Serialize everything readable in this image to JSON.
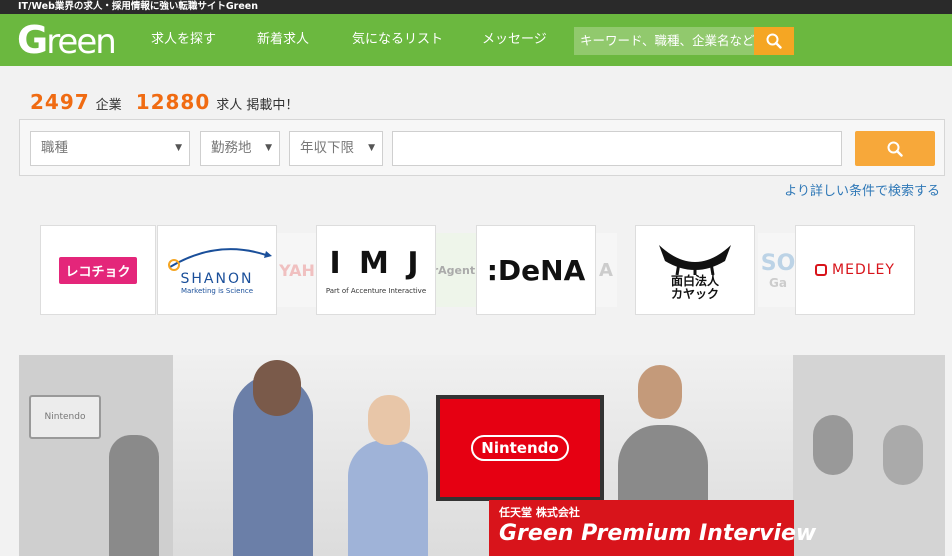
{
  "topbar": {
    "text": "IT/Web業界の求人・採用情報に強い転職サイトGreen"
  },
  "nav": {
    "brand": "reen",
    "brand_initial": "G",
    "links": [
      "求人を探す",
      "新着求人",
      "気になるリスト",
      "メッセージ"
    ],
    "search_placeholder": "キーワード、職種、企業名など"
  },
  "counts": {
    "companies": "2497",
    "companies_unit": "企業",
    "jobs": "12880",
    "jobs_unit": "求人 掲載中！"
  },
  "search": {
    "job_type": "職種",
    "location": "勤務地",
    "salary": "年収下限",
    "advanced_link": "より詳しい条件で検索する"
  },
  "logos": {
    "recochoku": "レコチョク",
    "shanon": "SHANON",
    "shanon_sub": "Marketing is Science",
    "imj": "I M J",
    "imj_sub": "Part of Accenture Interactive",
    "dena": ":DeNA",
    "kayac_1": "面白法人",
    "kayac_2": "カヤック",
    "medley": "MEDLEY",
    "faded_1": "YAH",
    "faded_2": "rAgent.",
    "faded_3": "SO",
    "faded_4": "Ga",
    "faded_5": "A"
  },
  "banner": {
    "company": "任天堂 株式会社",
    "title": "Green Premium Interview",
    "tv_text": "Nintendo",
    "wall_text": "Nintendo"
  },
  "colors": {
    "nav": "#6bb83f",
    "accent": "#f5a623",
    "count": "#f06b12",
    "link": "#2f78b7",
    "red": "#d8141b"
  }
}
